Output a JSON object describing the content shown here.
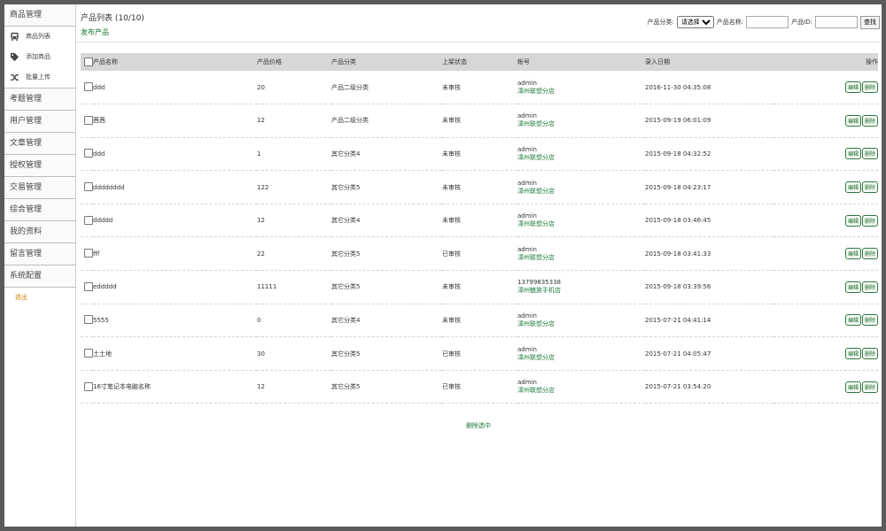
{
  "sidebar": {
    "goods_header": "商品管理",
    "goods_items": [
      {
        "label": "商品列表",
        "icon": "bus-icon"
      },
      {
        "label": "添加商品",
        "icon": "tags-icon"
      },
      {
        "label": "批量上传",
        "icon": "shuffle-icon"
      }
    ],
    "sections": [
      "考题管理",
      "用户管理",
      "文章管理",
      "授权管理",
      "交易管理",
      "综合管理",
      "我的资料",
      "留言管理",
      "系统配置"
    ],
    "logout": "退出"
  },
  "header": {
    "title": "产品列表 (10/10)",
    "publish": "发布产品",
    "filters": {
      "category_label": "产品分类:",
      "category_selected": "请选择",
      "name_label": "产品名称:",
      "name_value": "",
      "id_label": "产品ID:",
      "id_value": "",
      "search_button": "查找"
    }
  },
  "table": {
    "columns": [
      "产品名称",
      "产品价格",
      "产品分类",
      "上架状态",
      "帐号",
      "录入日期",
      "操作"
    ],
    "edit_label": "编辑",
    "delete_label": "删除",
    "rows": [
      {
        "name": "ddd",
        "price": "20",
        "category": "产品二级分类",
        "status": "未审核",
        "user": "admin",
        "store": "漳州联想分店",
        "date": "2016-11-30 04:35:08"
      },
      {
        "name": "茜茜",
        "price": "12",
        "category": "产品二级分类",
        "status": "未审核",
        "user": "admin",
        "store": "漳州联想分店",
        "date": "2015-09-19 06:01:09"
      },
      {
        "name": "ddd",
        "price": "1",
        "category": "其它分类4",
        "status": "未审核",
        "user": "admin",
        "store": "漳州联想分店",
        "date": "2015-09-18 04:32:52"
      },
      {
        "name": "dddddddd",
        "price": "122",
        "category": "其它分类5",
        "status": "未审核",
        "user": "admin",
        "store": "漳州联想分店",
        "date": "2015-09-18 04:23:17"
      },
      {
        "name": "ddddd",
        "price": "12",
        "category": "其它分类4",
        "status": "未审核",
        "user": "admin",
        "store": "漳州联想分店",
        "date": "2015-09-18 03:46:45"
      },
      {
        "name": "fff",
        "price": "22",
        "category": "其它分类5",
        "status": "已审核",
        "user": "admin",
        "store": "漳州联想分店",
        "date": "2015-09-18 03:41:33"
      },
      {
        "name": "eddddd",
        "price": "11111",
        "category": "其它分类5",
        "status": "未审核",
        "user": "13799835338",
        "store": "漳州魅族手机店",
        "date": "2015-09-18 03:39:56"
      },
      {
        "name": "5555",
        "price": "0",
        "category": "其它分类4",
        "status": "未审核",
        "user": "admin",
        "store": "漳州联想分店",
        "date": "2015-07-21 04:41:14"
      },
      {
        "name": "土土地",
        "price": "30",
        "category": "其它分类5",
        "status": "已审核",
        "user": "admin",
        "store": "漳州联想分店",
        "date": "2015-07-21 04:05:47"
      },
      {
        "name": "16寸笔记本电脑名称",
        "price": "12",
        "category": "其它分类5",
        "status": "已审核",
        "user": "admin",
        "store": "漳州联想分店",
        "date": "2015-07-21 03:54:20"
      }
    ]
  },
  "footer": {
    "delete_selected": "删除选中"
  }
}
